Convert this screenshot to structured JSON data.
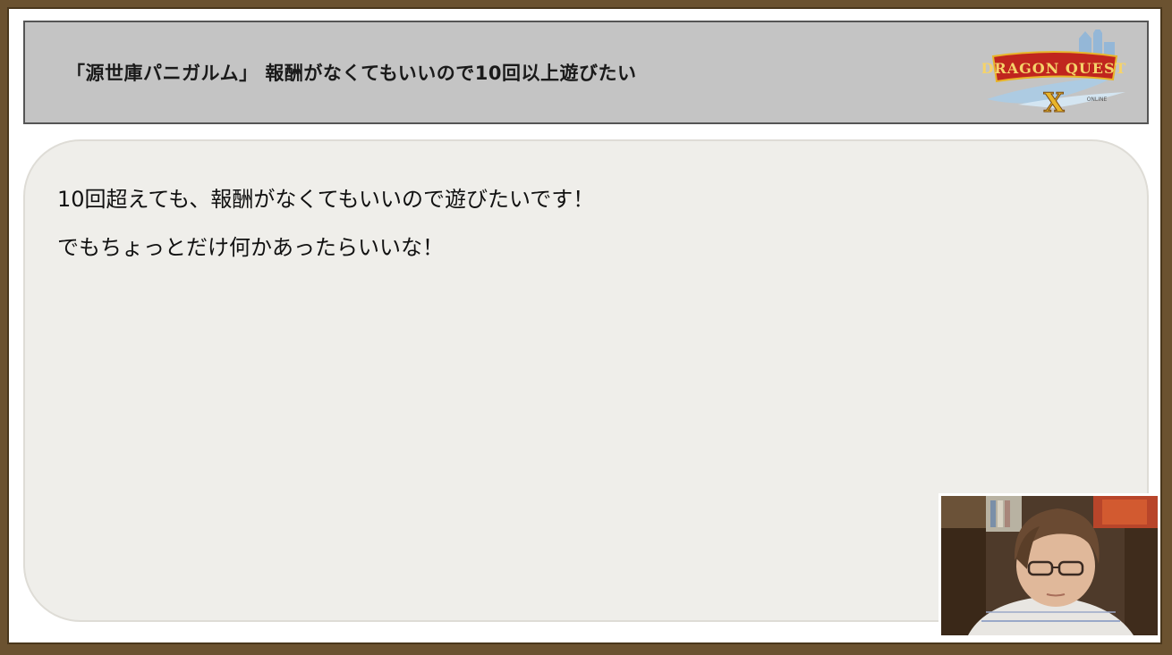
{
  "header": {
    "title": "「源世庫パニガルム」 報酬がなくてもいいので10回以上遊びたい",
    "logo_text": "DRAGON QUEST X"
  },
  "content": {
    "lines": [
      "10回超えても、報酬がなくてもいいので遊びたいです！",
      "でもちょっとだけ何かあったらいいな！"
    ]
  },
  "colors": {
    "border": "#6b5230",
    "title_bar": "#c4c4c4",
    "content_bg": "#efeeea",
    "logo_red": "#c0251e",
    "logo_gold": "#e8b52a"
  }
}
